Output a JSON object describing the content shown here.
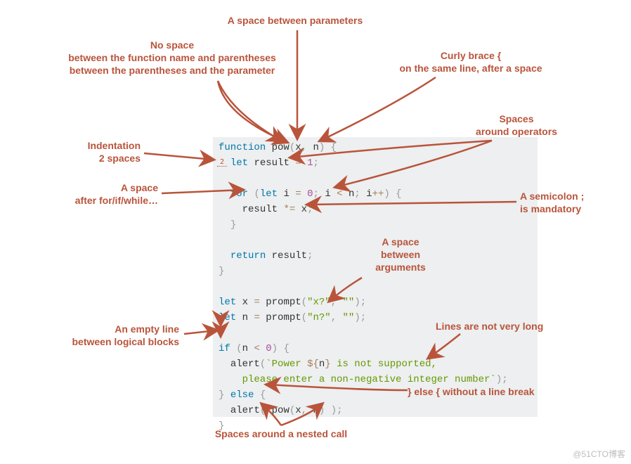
{
  "annotations": {
    "param_space": "A space between parameters",
    "no_space": "No space\nbetween the function name and parentheses\nbetween the parentheses and the parameter",
    "curly_brace": "Curly brace {\non the same line, after a space",
    "spaces_ops": "Spaces\naround operators",
    "indent": "Indentation\n2 spaces",
    "after_for": "A space\nafter for/if/while…",
    "semicolon": "A semicolon ;\nis mandatory",
    "between_args": "A space\nbetween\narguments",
    "empty_line": "An empty line\nbetween logical blocks",
    "lines_long": "Lines are not very long",
    "else_nobreak": "} else { without a line break",
    "nested_call": "Spaces around a nested call"
  },
  "code": {
    "l1": {
      "function": "function",
      "name": "pow",
      "lp": "(",
      "x": "x",
      "comma": ",",
      "sp": " ",
      "n": "n",
      "rp": ")",
      "lb": " {"
    },
    "l2": {
      "let": "let",
      "result": "result",
      "eq": "=",
      "one": "1",
      "semi": ";"
    },
    "l4": {
      "for": "for",
      "lp": "(",
      "let": "let",
      "i": "i",
      "eq": "=",
      "zero": "0",
      "semi1": ";",
      "i2": "i",
      "lt": "<",
      "n": "n",
      "semi2": ";",
      "i3": "i",
      "inc": "++",
      "rp": ")",
      "lb": " {"
    },
    "l5": {
      "result": "result",
      "me": "*=",
      "x": "x",
      "semi": ";"
    },
    "l6": {
      "rb": "}"
    },
    "l8": {
      "return": "return",
      "result": "result",
      "semi": ";"
    },
    "l9": {
      "rb": "}"
    },
    "l11": {
      "let": "let",
      "x": "x",
      "eq": "=",
      "prompt": "prompt",
      "lp": "(",
      "s1": "\"x?\"",
      "comma": ",",
      "sp": " ",
      "s2": "\"\"",
      "rp": ")",
      "semi": ";"
    },
    "l12": {
      "let": "let",
      "n": "n",
      "eq": "=",
      "prompt": "prompt",
      "lp": "(",
      "s1": "\"n?\"",
      "comma": ",",
      "sp": " ",
      "s2": "\"\"",
      "rp": ")",
      "semi": ";"
    },
    "l14": {
      "if": "if",
      "lp": "(",
      "n": "n",
      "lt": "<",
      "zero": "0",
      "rp": ")",
      "lb": " {"
    },
    "l15": {
      "alert": "alert",
      "lp": "(",
      "bt": "`",
      "t1": "Power ",
      "dl": "${",
      "n": "n",
      "dr": "}",
      "t2": " is not supported,",
      "cont": ""
    },
    "l16": {
      "t3": "    please enter a non-negative integer number",
      "bt": "`",
      "rp": ")",
      "semi": ";"
    },
    "l17": {
      "rb": "}",
      "else": "else",
      "lb": "{"
    },
    "l18": {
      "alert": "alert",
      "lp": "(",
      "sp1": " ",
      "pow": "pow",
      "lp2": "(",
      "x": "x",
      "comma": ",",
      "sp2": " ",
      "n": "n",
      "rp2": ")",
      "sp3": " ",
      "rp": ")",
      "semi": ";"
    },
    "l19": {
      "rb": "}"
    }
  },
  "indent_label": "2",
  "watermark": "@51CTO博客"
}
